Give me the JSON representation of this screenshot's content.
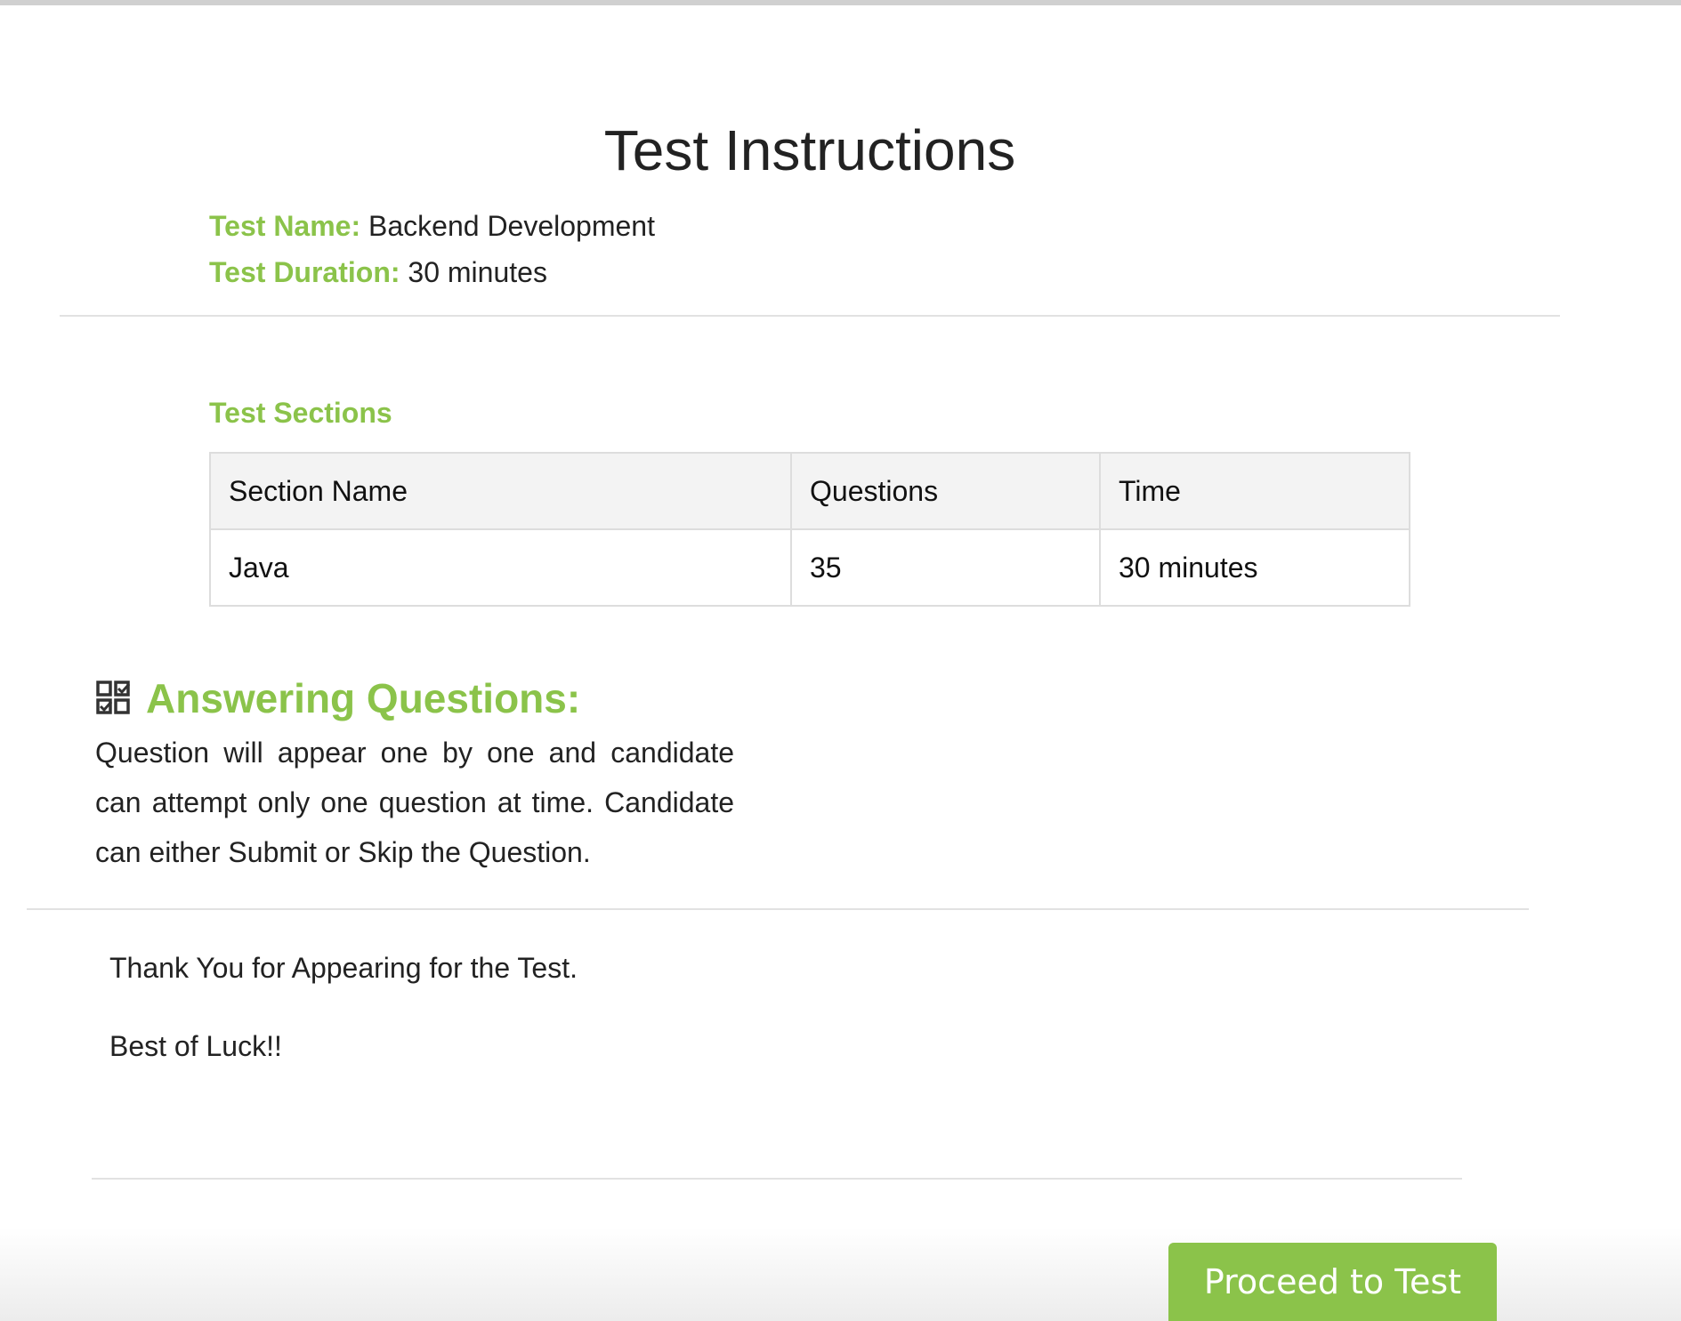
{
  "page": {
    "title": "Test Instructions"
  },
  "test_info": {
    "name_label": "Test Name:",
    "name_value": "Backend Development",
    "duration_label": "Test Duration:",
    "duration_value": "30 minutes"
  },
  "sections": {
    "title": "Test Sections",
    "columns": [
      "Section Name",
      "Questions",
      "Time"
    ],
    "rows": [
      [
        "Java",
        "35",
        "30 minutes"
      ]
    ]
  },
  "answering": {
    "icon": "qr-checklist-icon",
    "title": "Answering Questions:",
    "text": "Question will appear one by one and candidate can attempt only one question at time. Candidate can either Submit or Skip the Question."
  },
  "closing": {
    "thanks": "Thank You for Appearing for the Test.",
    "luck": "Best of Luck!!"
  },
  "actions": {
    "proceed_label": "Proceed to Test"
  },
  "colors": {
    "accent": "#8bc34a",
    "text": "#222222",
    "table_header_bg": "#f3f3f3",
    "border": "#dddddd"
  }
}
